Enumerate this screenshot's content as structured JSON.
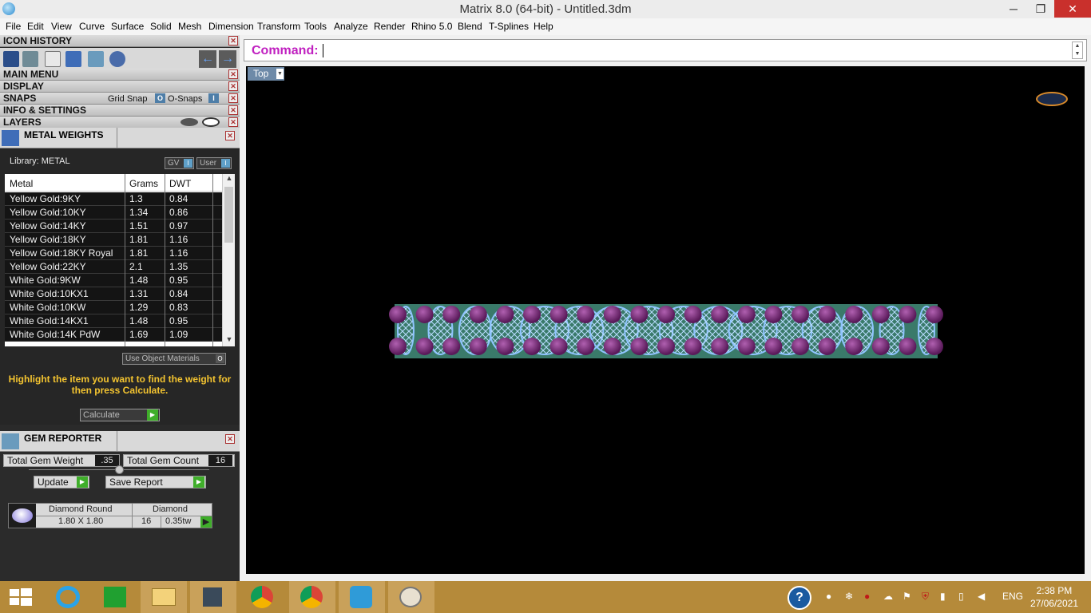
{
  "window": {
    "title": "Matrix 8.0 (64-bit) - Untitled.3dm",
    "minimize": "─",
    "restore": "❐",
    "close": "✕"
  },
  "menu": [
    "File",
    "Edit",
    "View",
    "Curve",
    "Surface",
    "Solid",
    "Mesh",
    "Dimension",
    "Transform",
    "Tools",
    "Analyze",
    "Render",
    "Rhino 5.0",
    "Blend",
    "T-Splines",
    "Help"
  ],
  "panels": {
    "icon_history": "ICON HISTORY",
    "main_menu": "MAIN MENU",
    "display": "DISPLAY",
    "snaps": "SNAPS",
    "grid_snap": "Grid Snap",
    "grid_snap_indicator": "O",
    "o_snaps": "O-Snaps",
    "o_snaps_indicator": "I",
    "info_settings": "INFO & SETTINGS",
    "layers": "LAYERS",
    "close_glyph": "✕"
  },
  "metal_weights": {
    "title": "METAL WEIGHTS",
    "library_label": "Library: METAL",
    "gv_label": "GV",
    "gv_indicator": "I",
    "user_label": "User",
    "user_indicator": "I",
    "columns": [
      "Metal",
      "Grams",
      "DWT"
    ],
    "rows": [
      {
        "metal": "Yellow Gold:9KY",
        "grams": "1.3",
        "dwt": "0.84"
      },
      {
        "metal": "Yellow Gold:10KY",
        "grams": "1.34",
        "dwt": "0.86"
      },
      {
        "metal": "Yellow Gold:14KY",
        "grams": "1.51",
        "dwt": "0.97"
      },
      {
        "metal": "Yellow Gold:18KY",
        "grams": "1.81",
        "dwt": "1.16"
      },
      {
        "metal": "Yellow Gold:18KY Royal",
        "grams": "1.81",
        "dwt": "1.16"
      },
      {
        "metal": "Yellow Gold:22KY",
        "grams": "2.1",
        "dwt": "1.35"
      },
      {
        "metal": "White Gold:9KW",
        "grams": "1.48",
        "dwt": "0.95"
      },
      {
        "metal": "White Gold:10KX1",
        "grams": "1.31",
        "dwt": "0.84"
      },
      {
        "metal": "White Gold:10KW",
        "grams": "1.29",
        "dwt": "0.83"
      },
      {
        "metal": "White Gold:14KX1",
        "grams": "1.48",
        "dwt": "0.95"
      },
      {
        "metal": "White Gold:14K PdW",
        "grams": "1.69",
        "dwt": "1.09"
      }
    ],
    "use_object_materials": "Use Object Materials",
    "use_object_materials_indicator": "O",
    "hint": "Highlight the item you want to find the weight for then press Calculate.",
    "calculate": "Calculate"
  },
  "gem_reporter": {
    "title": "GEM REPORTER",
    "total_weight_label": "Total Gem Weight",
    "total_weight_value": ".35",
    "total_count_label": "Total Gem Count",
    "total_count_value": "16",
    "update": "Update",
    "save_report": "Save Report",
    "gem_shape": "Diamond Round",
    "gem_type": "Diamond",
    "gem_size": "1.80 X 1.80",
    "gem_count": "16",
    "gem_weight": "0.35tw"
  },
  "command": {
    "label": "Command:",
    "value": ""
  },
  "viewport": {
    "name": "Top"
  },
  "taskbar": {
    "language": "ENG",
    "time": "2:38 PM",
    "date": "27/06/2021"
  },
  "colors": {
    "command_label": "#c020c0",
    "hint_text": "#f4c430",
    "taskbar": "#b58a3a",
    "ring_gem": "#8fc4ff",
    "ring_prong": "#7a2a7a",
    "ring_band": "#3a7a6a"
  }
}
